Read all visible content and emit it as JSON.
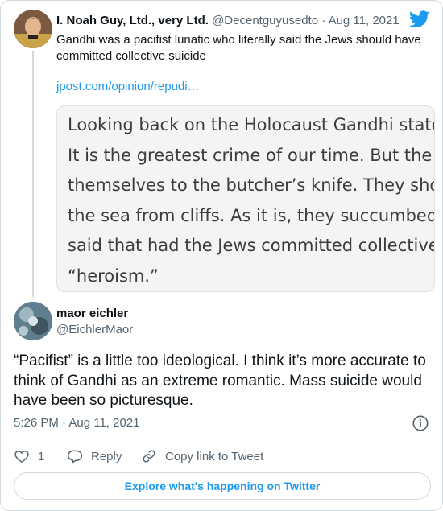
{
  "parent": {
    "display_name": "I. Noah Guy, Ltd., very Ltd.",
    "handle": "@Decentguyusedto",
    "separator": "·",
    "date": "Aug 11, 2021",
    "text": "Gandhi was a pacifist lunatic who literally said the Jews should have committed collective suicide",
    "link": "jpost.com/opinion/repudi…",
    "quote_lines": [
      "Looking back on the Holocaust Gandhi stated:",
      "It is the greatest crime of our time. But the Jews",
      "themselves to the butcher’s knife. They should have",
      "the sea from cliffs. As it is, they succumbed anyway",
      "said that had the Jews committed collective suicide",
      "“heroism.”"
    ]
  },
  "reply": {
    "display_name": "maor eichler",
    "handle": "@EichlerMaor",
    "text": "“Pacifist” is a little too ideological. I think it’s more accurate to think of Gandhi as an extreme romantic. Mass suicide would have been so picturesque.",
    "timestamp": "5:26 PM · Aug 11, 2021"
  },
  "actions": {
    "like_count": "1",
    "reply_label": "Reply",
    "copy_label": "Copy link to Tweet"
  },
  "explore_label": "Explore what's happening on Twitter",
  "colors": {
    "accent": "#1d9bf0",
    "text": "#0f1419",
    "muted": "#536471",
    "border": "#cfd9de"
  },
  "icons": [
    "twitter-bird-icon",
    "info-icon",
    "heart-icon",
    "reply-icon",
    "link-icon"
  ]
}
